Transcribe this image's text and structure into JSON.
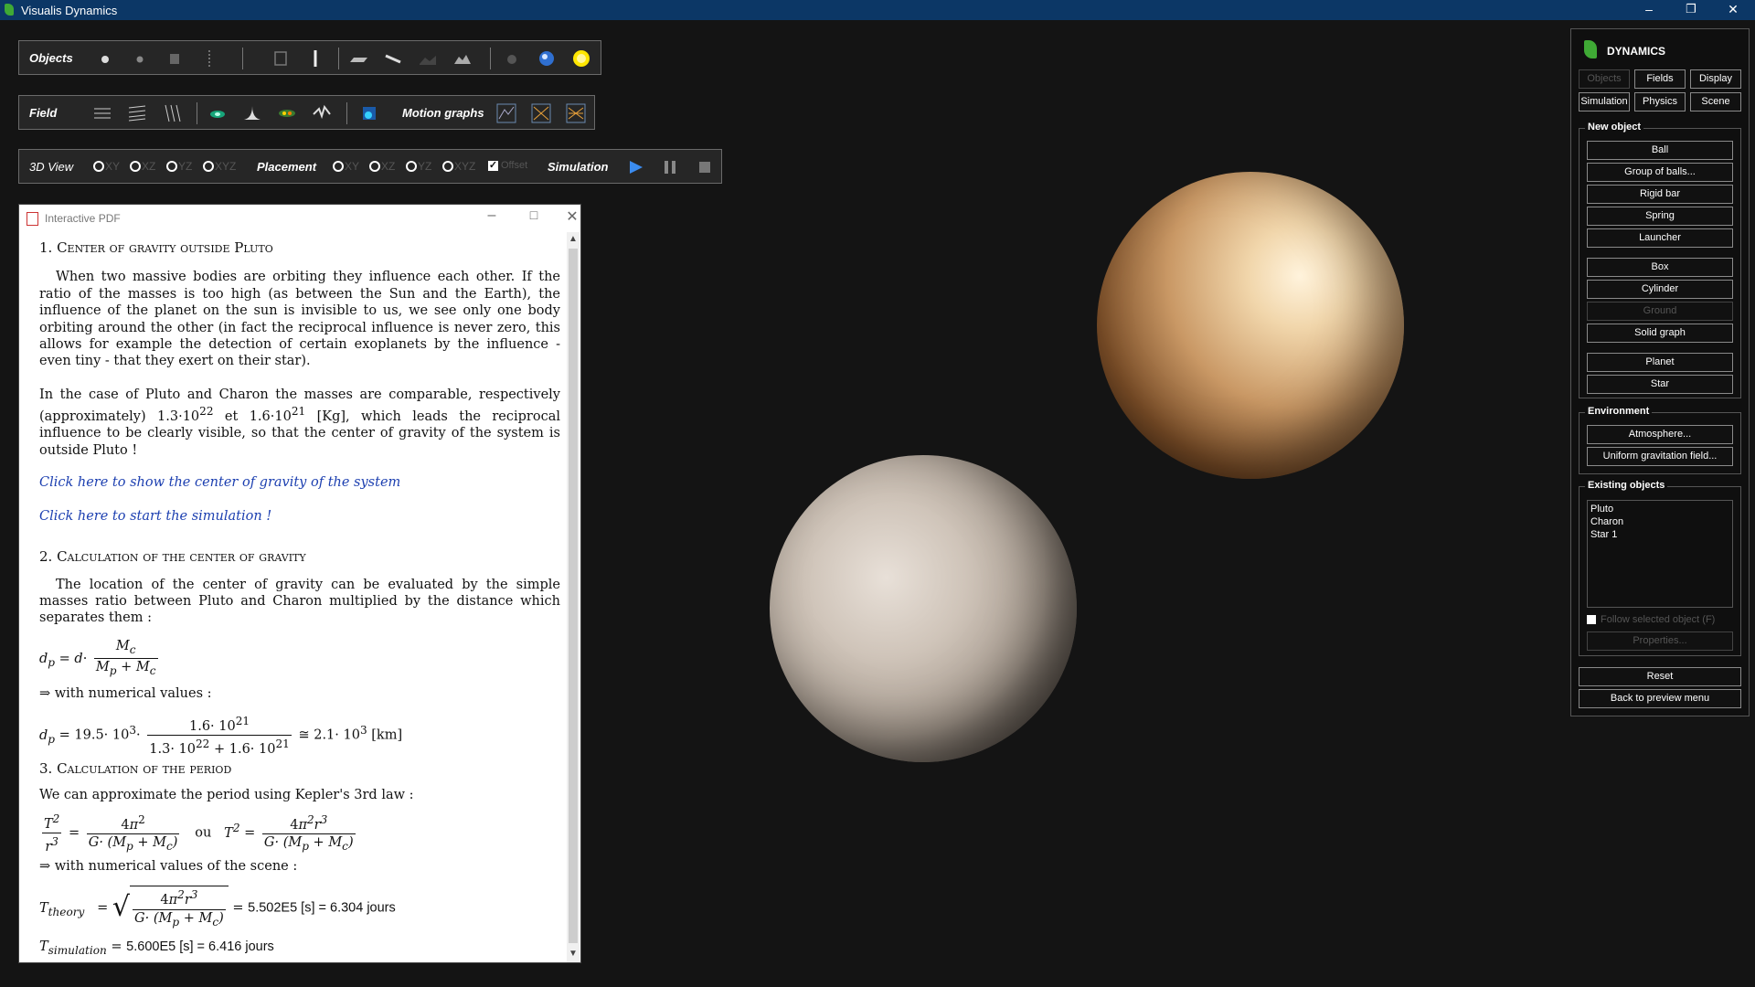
{
  "window": {
    "title": "Visualis Dynamics"
  },
  "toolbar_objects": {
    "label": "Objects"
  },
  "toolbar_field": {
    "label": "Field",
    "motion_label": "Motion graphs"
  },
  "toolbar_view": {
    "view_label": "3D View",
    "view_options": [
      "XY",
      "XZ",
      "YZ",
      "XYZ"
    ],
    "placement_label": "Placement",
    "placement_options": [
      "XY",
      "XZ",
      "YZ",
      "XYZ"
    ],
    "offset_label": "Offset",
    "offset_checked": true,
    "simulation_label": "Simulation"
  },
  "pdf": {
    "title": "Interactive PDF",
    "s1_title": "1. Center of gravity outside Pluto",
    "s1_p1": "When two massive bodies are orbiting they influence each other. If the ratio of the masses is too high (as between the Sun and the Earth), the influence of the planet on the sun is invisible to us, we see only one body orbiting around the other (in fact the reciprocal influence is never zero, this allows for example the detection of certain exoplanets by the influence - even tiny - that they exert on their star).",
    "s1_p2a": "In the case of Pluto and Charon the masses are comparable, respectively (approximately) 1.3·10",
    "s1_p2_exp1": "22",
    "s1_p2b": " et 1.6·10",
    "s1_p2_exp2": "21",
    "s1_p2c": " [Kg], which leads the reciprocal influence to be clearly visible, so that the center of gravity of the system is outside Pluto !",
    "link_center": "Click here to show the center of gravity of the system",
    "link_sim": "Click here to start the simulation !",
    "s2_title": "2. Calculation of the center of gravity",
    "s2_p1": "The location of the center of gravity can be evaluated by the simple masses ratio between Pluto and Charon multiplied by the distance which separates them :",
    "with_num": "⇒ with numerical values :",
    "s3_title": "3. Calculation of the period",
    "s3_p1": "We can approximate the period using Kepler's 3rd law :",
    "ou": "ou",
    "with_num_scene": "⇒ with numerical values of the scene :",
    "t_theory_value": "5.502E5 [s] = 6.304 jours",
    "t_sim_value": "5.600E5 [s] = 6.416 jours"
  },
  "panel": {
    "brand": "DYNAMICS",
    "tabs": [
      "Objects",
      "Fields",
      "Display",
      "Simulation",
      "Physics",
      "Scene"
    ],
    "new_object_title": "New object",
    "new_objects": [
      "Ball",
      "Group of balls...",
      "Rigid bar",
      "Spring",
      "Launcher",
      "Box",
      "Cylinder",
      "Ground",
      "Solid graph",
      "Planet",
      "Star"
    ],
    "environment_title": "Environment",
    "environment": [
      "Atmosphere...",
      "Uniform gravitation field..."
    ],
    "existing_title": "Existing objects",
    "existing_objects": [
      "Pluto",
      "Charon",
      "Star 1"
    ],
    "follow_label": "Follow selected object (F)",
    "properties_label": "Properties...",
    "reset_label": "Reset",
    "back_label": "Back to preview menu"
  },
  "colors": {
    "titlebar": "#0c3766",
    "background": "#141414",
    "brand_green": "#3fa935",
    "link": "#1c3fb0"
  }
}
